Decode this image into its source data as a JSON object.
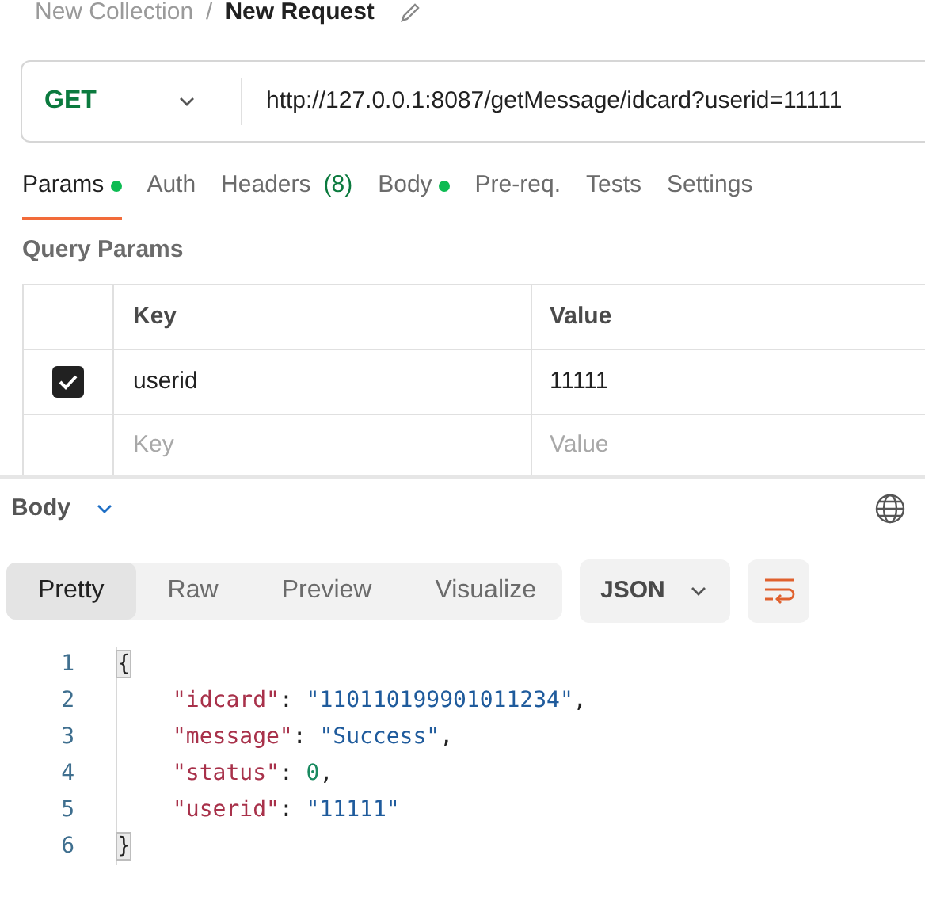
{
  "breadcrumb": {
    "collection": "New Collection",
    "separator": "/",
    "request": "New Request"
  },
  "request": {
    "method": "GET",
    "url": "http://127.0.0.1:8087/getMessage/idcard?userid=11111"
  },
  "tabs": [
    {
      "label": "Params",
      "selected": true,
      "dot": true
    },
    {
      "label": "Auth",
      "selected": false,
      "dot": false
    },
    {
      "label": "Headers",
      "selected": false,
      "dot": false,
      "count": "(8)"
    },
    {
      "label": "Body",
      "selected": false,
      "dot": true
    },
    {
      "label": "Pre-req.",
      "selected": false,
      "dot": false
    },
    {
      "label": "Tests",
      "selected": false,
      "dot": false
    },
    {
      "label": "Settings",
      "selected": false,
      "dot": false
    }
  ],
  "query_params": {
    "title": "Query Params",
    "columns": [
      "Key",
      "Value"
    ],
    "rows": [
      {
        "checked": true,
        "key": "userid",
        "value": "11111"
      }
    ],
    "placeholder_row": {
      "key": "Key",
      "value": "Value"
    }
  },
  "response": {
    "label": "Body",
    "view_tabs": [
      {
        "label": "Pretty",
        "selected": true
      },
      {
        "label": "Raw",
        "selected": false
      },
      {
        "label": "Preview",
        "selected": false
      },
      {
        "label": "Visualize",
        "selected": false
      }
    ],
    "format": "JSON",
    "code": [
      {
        "number": "1",
        "indented": false,
        "tokens": [
          {
            "kind": "brace",
            "text": "{"
          }
        ]
      },
      {
        "number": "2",
        "indented": true,
        "tokens": [
          {
            "kind": "key",
            "text": "\"idcard\""
          },
          {
            "kind": "punct",
            "text": ": "
          },
          {
            "kind": "string",
            "text": "\"110110199901011234\""
          },
          {
            "kind": "punct",
            "text": ","
          }
        ]
      },
      {
        "number": "3",
        "indented": true,
        "tokens": [
          {
            "kind": "key",
            "text": "\"message\""
          },
          {
            "kind": "punct",
            "text": ": "
          },
          {
            "kind": "string",
            "text": "\"Success\""
          },
          {
            "kind": "punct",
            "text": ","
          }
        ]
      },
      {
        "number": "4",
        "indented": true,
        "tokens": [
          {
            "kind": "key",
            "text": "\"status\""
          },
          {
            "kind": "punct",
            "text": ": "
          },
          {
            "kind": "number",
            "text": "0"
          },
          {
            "kind": "punct",
            "text": ","
          }
        ]
      },
      {
        "number": "5",
        "indented": true,
        "tokens": [
          {
            "kind": "key",
            "text": "\"userid\""
          },
          {
            "kind": "punct",
            "text": ": "
          },
          {
            "kind": "string",
            "text": "\"11111\""
          }
        ]
      },
      {
        "number": "6",
        "indented": false,
        "tokens": [
          {
            "kind": "brace",
            "text": "}"
          }
        ]
      }
    ]
  }
}
